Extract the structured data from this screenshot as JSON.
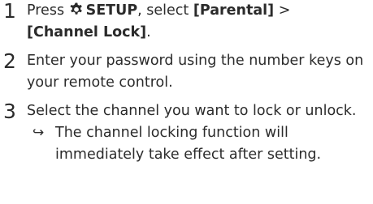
{
  "steps": [
    {
      "number": "1",
      "parts": {
        "press": "Press ",
        "setup": "SETUP",
        "select": ", select ",
        "parental": "[Parental]",
        "arrow": " >",
        "channel_lock": "[Channel Lock]",
        "end": "."
      }
    },
    {
      "number": "2",
      "text": "Enter your password using the number keys on your remote control."
    },
    {
      "number": "3",
      "text": "Select the channel you want to lock or unlock.",
      "result_arrow": "↪",
      "result": "The channel locking function will immediately take effect after setting."
    }
  ],
  "icons": {
    "setup": "gear-icon",
    "result": "result-arrow-icon"
  }
}
